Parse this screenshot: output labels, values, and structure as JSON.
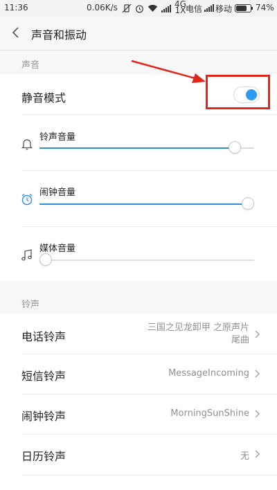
{
  "status_bar": {
    "time": "11:36",
    "speed": "0.06K/s",
    "carrier_1": "电信",
    "carrier_2": "移动",
    "battery": "74%",
    "network_badge": "4G",
    "network_badge_sub": "1X",
    "battery_level": 0.74
  },
  "header": {
    "title": "声音和振动"
  },
  "sound_section": {
    "label": "声音",
    "silent_mode": {
      "label": "静音模式",
      "enabled": true
    },
    "ringtone_volume": {
      "label": "铃声音量",
      "icon": "bell-icon",
      "level": 0.91
    },
    "alarm_volume": {
      "label": "闹钟音量",
      "icon": "alarm-clock-icon",
      "level": 0.97
    },
    "media_volume": {
      "label": "媒体音量",
      "icon": "music-note-icon",
      "level": 0.03
    }
  },
  "ringtone_section": {
    "label": "铃声",
    "items": [
      {
        "label": "电话铃声",
        "value_line1": "三国之见龙卸甲 之原声片",
        "value_line2": "尾曲"
      },
      {
        "label": "短信铃声",
        "value_line1": "MessageIncoming"
      },
      {
        "label": "闹钟铃声",
        "value_line1": "MorningSunShine"
      },
      {
        "label": "日历铃声",
        "value_line1": "无"
      }
    ]
  },
  "colors": {
    "accent": "#2f9bf0",
    "annotation": "#e1251b"
  }
}
